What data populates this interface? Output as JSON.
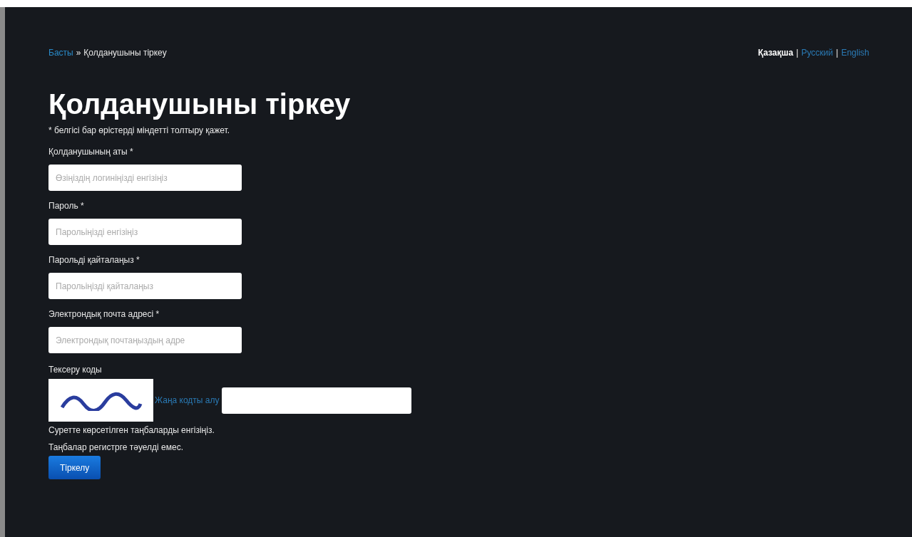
{
  "breadcrumb": {
    "home": "Басты",
    "separator": "»",
    "current": "Қолданушыны тіркеу"
  },
  "languages": [
    {
      "label": "Қазақша",
      "selected": true
    },
    {
      "label": "Русский",
      "selected": false
    },
    {
      "label": "English",
      "selected": false
    }
  ],
  "language_separator": "|",
  "title": "Қолданушыны тіркеу",
  "note": "* белгісі бар өрістерді міндетті толтыру қажет.",
  "fields": [
    {
      "label": "Қолданушының аты *",
      "placeholder": "Өзіңіздің логиніңізді енгізіңіз"
    },
    {
      "label": "Пароль *",
      "placeholder": "Парольіңізді енгізіңіз"
    },
    {
      "label": "Парольді қайталаңыз *",
      "placeholder": "Парольіңізді қайталаңыз"
    },
    {
      "label": "Электрондық почта адресі *",
      "placeholder": "Электрондық почтаңыздың адре"
    }
  ],
  "captcha": {
    "label": "Тексеру коды",
    "refresh_link": "Жаңа кодты алу",
    "hint_lines": [
      "Суретте көрсетілген таңбаларды енгізіңіз.",
      "Таңбалар регистрге тәуелді емес."
    ]
  },
  "submit": "Тіркелу"
}
